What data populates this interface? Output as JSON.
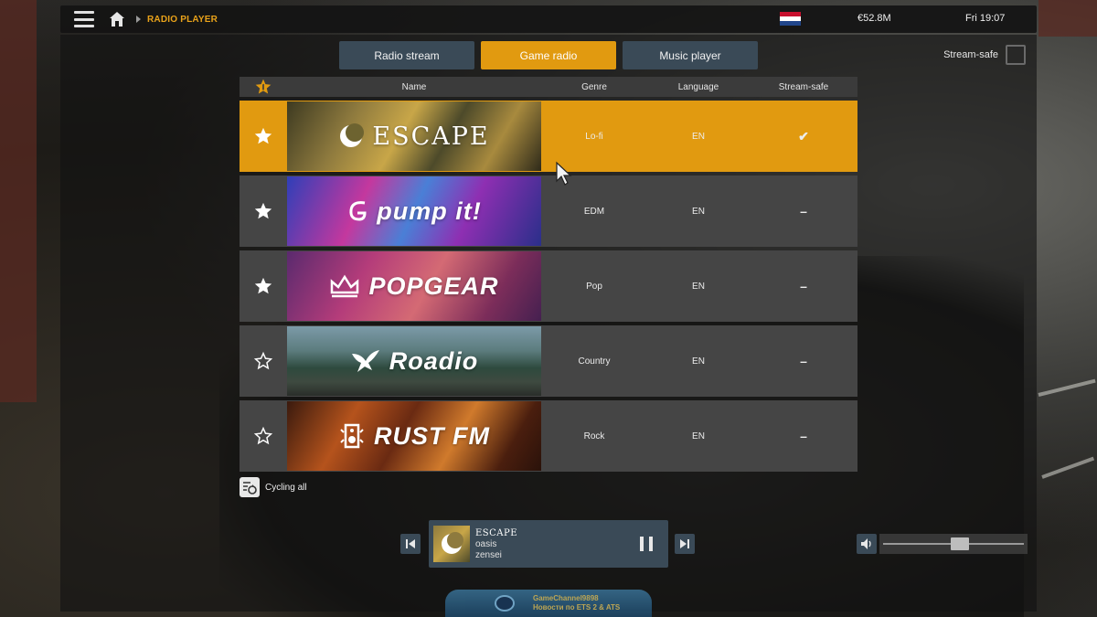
{
  "topbar": {
    "breadcrumb": "RADIO PLAYER",
    "money": "€52.8M",
    "clock": "Fri 19:07",
    "flag_colors": [
      "#c8102e",
      "#ffffff",
      "#21468b"
    ]
  },
  "tabs": [
    {
      "label": "Radio stream",
      "active": false
    },
    {
      "label": "Game radio",
      "active": true
    },
    {
      "label": "Music player",
      "active": false
    }
  ],
  "stream_safe_filter": {
    "label": "Stream-safe",
    "checked": false
  },
  "table": {
    "headers": {
      "name": "Name",
      "genre": "Genre",
      "language": "Language",
      "stream_safe": "Stream-safe"
    },
    "rows": [
      {
        "name": "ESCAPE",
        "genre": "Lo-fi",
        "language": "EN",
        "stream_safe": "✔",
        "favorite": true,
        "selected": true
      },
      {
        "name": "pump it!",
        "genre": "EDM",
        "language": "EN",
        "stream_safe": "–",
        "favorite": true,
        "selected": false
      },
      {
        "name": "POPGEAR",
        "genre": "Pop",
        "language": "EN",
        "stream_safe": "–",
        "favorite": true,
        "selected": false
      },
      {
        "name": "Roadio",
        "genre": "Country",
        "language": "EN",
        "stream_safe": "–",
        "favorite": false,
        "selected": false
      },
      {
        "name": "RUST FM",
        "genre": "Rock",
        "language": "EN",
        "stream_safe": "–",
        "favorite": false,
        "selected": false
      }
    ]
  },
  "cycling": {
    "label": "Cycling all"
  },
  "player": {
    "station": "ESCAPE",
    "track": "oasis",
    "artist": "zensei",
    "volume_fraction": 0.55
  },
  "watermark": {
    "line1": "GameChannel9898",
    "line2": "Новости по ETS 2 & ATS"
  },
  "colors": {
    "accent": "#e19a10",
    "tab": "#3a4a57",
    "row": "#454545"
  }
}
